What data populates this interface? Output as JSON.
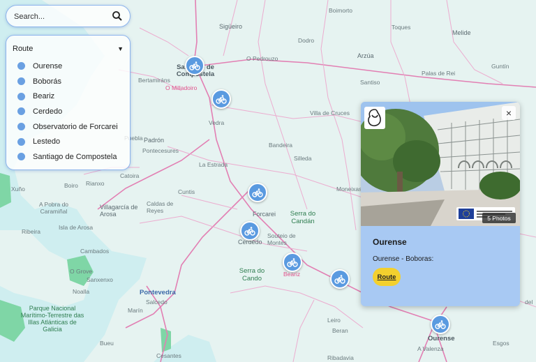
{
  "search": {
    "placeholder": "Search..."
  },
  "routes_panel": {
    "header": "Route",
    "items": [
      "Ourense",
      "Boborás",
      "Beariz",
      "Cerdedo",
      "Observatorio de Forcarei",
      "Lestedo",
      "Santiago de Compostela"
    ]
  },
  "popup": {
    "title": "Ourense",
    "description": "Ourense - Boboras:",
    "button_label": "Route",
    "photos_label": "5 Photos",
    "close_symbol": "×"
  },
  "map_labels": {
    "l1": "Boimorto",
    "l2": "Sigüeiro",
    "l3": "Dodro",
    "l4": "Toques",
    "l5": "O Pedrouzo",
    "l6": "Santiago de Compostela",
    "l7": "Bertamiráns",
    "l8": "O Milladoiro",
    "l9": "Arzúa",
    "l10": "Melide",
    "l11": "Palas de Rei",
    "l12": "Guntín",
    "l13": "Santiso",
    "l14": "Vedra",
    "l15": "Villa de Cruces",
    "l16": "Padrón",
    "l17": "Bandeira",
    "l18": "Puebla",
    "l19": "Pontecesures",
    "l20": "Silleda",
    "l21": "La Estrada",
    "l22": "Catoira",
    "l23": "Cuntis",
    "l24": "Xuño",
    "l25": "Boiro",
    "l26": "Rianxo",
    "l27": "Caldas de Reyes",
    "l28": "A Pobra do Caramiñal",
    "l29": "Villagarcía de Arosa",
    "l30": "Forcarei",
    "l31": "Serra do Candán",
    "l32": "Isla de Arosa",
    "l33": "Ribeira",
    "l34": "Cerdedo",
    "l35": "Souteio de Montes",
    "l36": "Cambados",
    "l37": "Serra do Cando",
    "l38": "Beariz",
    "l39": "Moneixas",
    "l40": "O Grove",
    "l41": "Sanxenxo",
    "l42": "Noalla",
    "l43": "Pontevedra",
    "l44": "Salcedo",
    "l45": "Parque Nacional Marítimo-Terrestre das Illas Atlánticas de Galicia",
    "l46": "Marín",
    "l47": "Leiro",
    "l48": "Beran",
    "l49": "Ourense",
    "l50": "A Valenza",
    "l51": "Esgos",
    "l52": "Bueu",
    "l53": "Cesantes",
    "l54": "Ribadavia",
    "l55": "del"
  },
  "colors": {
    "water": "#cfeef0",
    "land": "#e8f4f2",
    "roads": "#e27fb3",
    "minor_roads": "#ecaccf",
    "pin": "#5a9ae0",
    "popup_bg": "#a8c9f3",
    "button": "#f3d02e"
  }
}
